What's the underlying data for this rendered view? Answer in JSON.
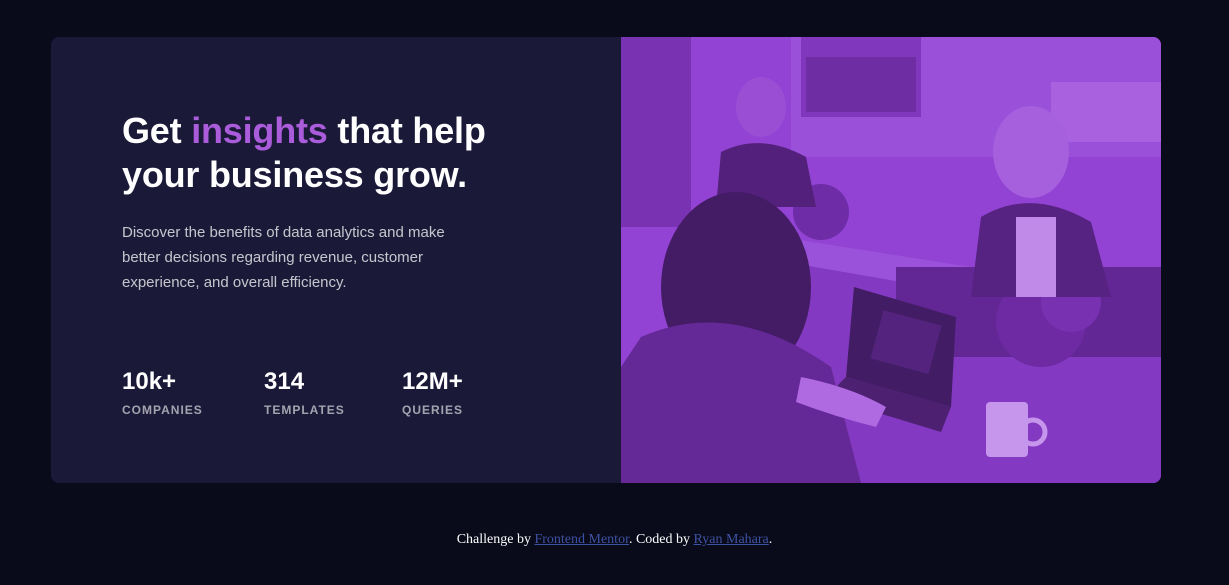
{
  "hero": {
    "headline_before": "Get ",
    "headline_accent": "insights",
    "headline_after": " that help your business grow.",
    "description": "Discover the benefits of data analytics and make better decisions regarding revenue, customer experience, and overall efficiency."
  },
  "stats": [
    {
      "value": "10k+",
      "label": "COMPANIES"
    },
    {
      "value": "314",
      "label": "TEMPLATES"
    },
    {
      "value": "12M+",
      "label": "QUERIES"
    }
  ],
  "attribution": {
    "prefix": "Challenge by ",
    "link1": "Frontend Mentor",
    "middle": ". Coded by ",
    "link2": "Ryan Mahara",
    "suffix": "."
  },
  "colors": {
    "page_background": "#090b1a",
    "card_background": "#1b1938",
    "accent": "#aa5cdb",
    "image_overlay": "#8f3fd0",
    "link": "#3e52a3"
  },
  "image": {
    "icon": "office-team-photo"
  }
}
